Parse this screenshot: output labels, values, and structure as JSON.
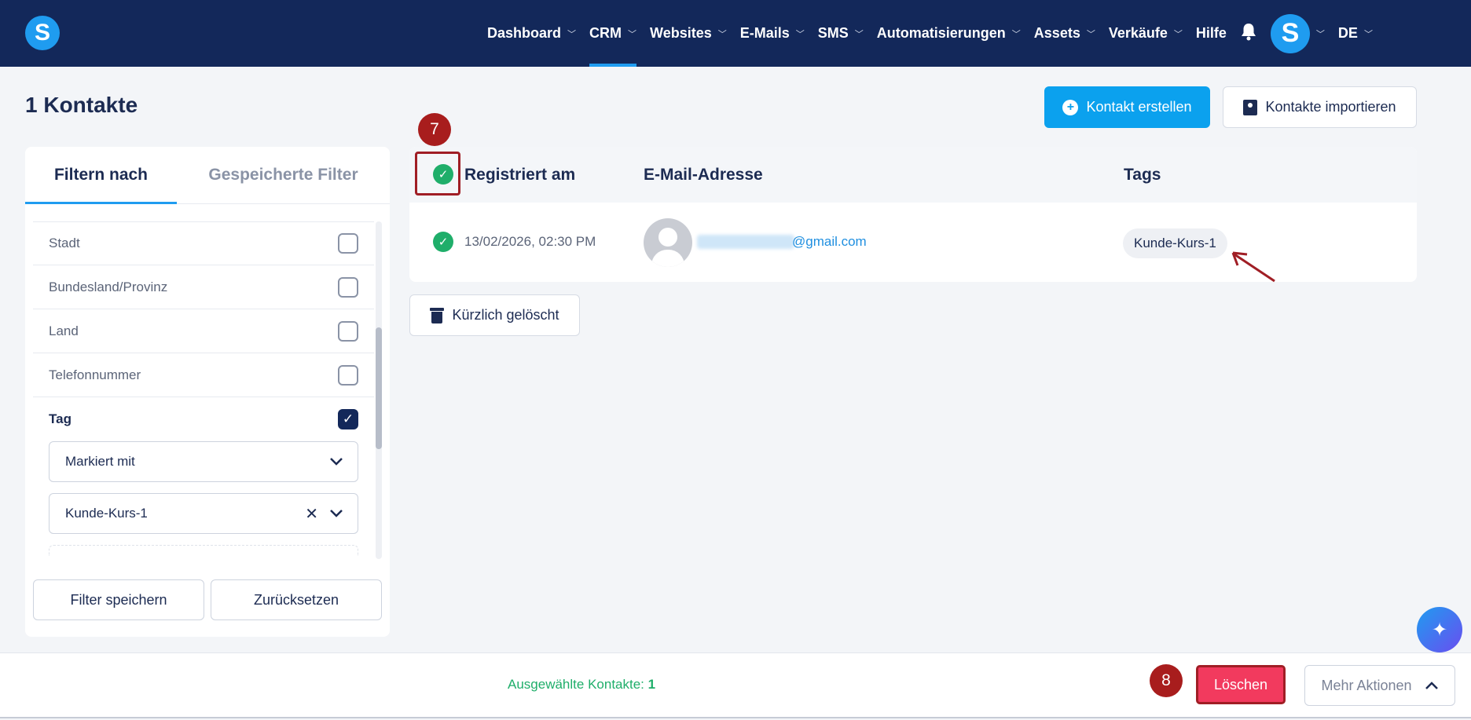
{
  "app": {
    "logo_letter": "S",
    "accent": "#1f9cf0",
    "nav_bg": "#13285a"
  },
  "nav": {
    "items": [
      {
        "label": "Dashboard"
      },
      {
        "label": "CRM"
      },
      {
        "label": "Websites"
      },
      {
        "label": "E-Mails"
      },
      {
        "label": "SMS"
      },
      {
        "label": "Automatisierungen"
      },
      {
        "label": "Assets"
      },
      {
        "label": "Verkäufe"
      }
    ],
    "help": "Hilfe",
    "avatar_letter": "S",
    "language": "DE"
  },
  "page": {
    "title": "1 Kontakte",
    "create_button": "Kontakt erstellen",
    "import_button": "Kontakte importieren",
    "recently_deleted": "Kürzlich gelöscht"
  },
  "filter": {
    "tabs": [
      "Filtern nach",
      "Gespeicherte Filter"
    ],
    "rows": [
      "Stadt",
      "Bundesland/Provinz",
      "Land",
      "Telefonnummer"
    ],
    "tag_label": "Tag",
    "condition": "Markiert mit",
    "tag_value": "Kunde-Kurs-1",
    "save_button": "Filter speichern",
    "reset_button": "Zurücksetzen"
  },
  "table": {
    "columns": [
      "Registriert am",
      "E-Mail-Adresse",
      "Tags"
    ],
    "rows": [
      {
        "date": "13/02/2026, 02:30 PM",
        "email": "@gmail.com",
        "tag": "Kunde-Kurs-1"
      }
    ]
  },
  "annotations": {
    "step_a": "7",
    "step_b": "8",
    "highlight_color": "#a01e25"
  },
  "bottom": {
    "selected_label": "Ausgewählte Kontakte:",
    "selected_count": "1",
    "delete_button": "Löschen",
    "more_actions": "Mehr Aktionen"
  }
}
